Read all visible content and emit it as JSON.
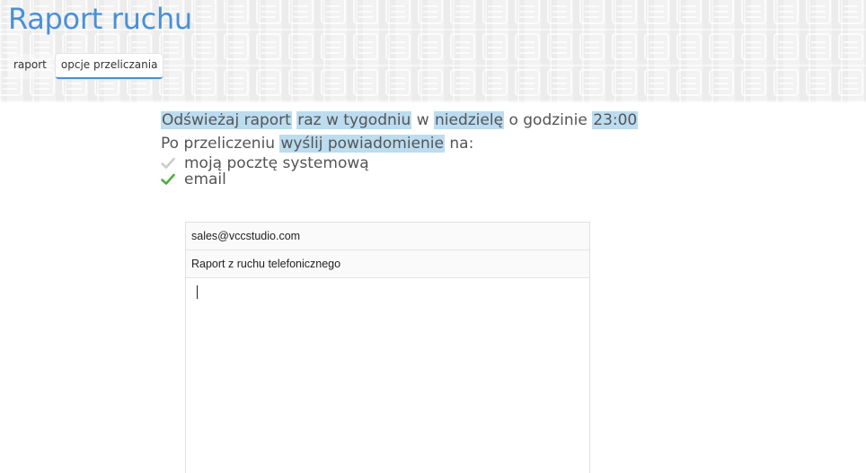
{
  "title": "Raport ruchu",
  "tabs": [
    {
      "label": "raport",
      "active": false
    },
    {
      "label": "opcje przeliczania",
      "active": true
    }
  ],
  "schedule": {
    "refresh": "Odświeżaj raport",
    "frequency": "raz w tygodniu",
    "in_word": "w",
    "day": "niedzielę",
    "at_word": "o godzinie",
    "time": "23:00"
  },
  "notify": {
    "prefix": "Po przeliczeniu",
    "action": "wyślij powiadomienie",
    "suffix": "na:",
    "options": [
      {
        "label": "moją pocztę systemową",
        "checked": false,
        "icon": "check-icon"
      },
      {
        "label": "email",
        "checked": true,
        "icon": "check-icon"
      }
    ]
  },
  "email": {
    "to": "sales@vccstudio.com",
    "subject": "Raport z ruchu telefonicznego",
    "body": ""
  },
  "colors": {
    "accent": "#4a90d6",
    "highlight": "#bcdcf0",
    "check_on": "#4caf3a",
    "check_off": "#cccccc"
  }
}
